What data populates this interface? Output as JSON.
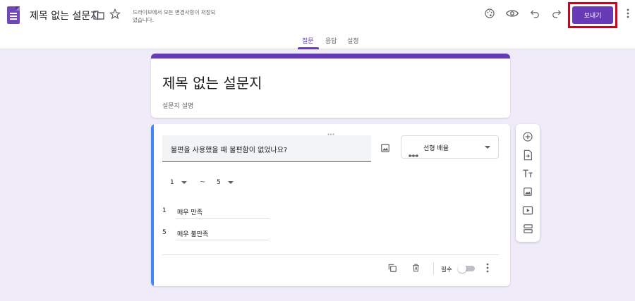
{
  "header": {
    "doc_title": "제목 없는 설문지",
    "save_status": "드라이브에서 모든 변경사항이 저장되었습니다.",
    "send_label": "보내기",
    "icons": [
      "forms-logo-icon",
      "folder-icon",
      "star-icon",
      "palette-icon",
      "preview-icon",
      "undo-icon",
      "redo-icon",
      "more-vert-icon"
    ]
  },
  "tabs": [
    {
      "label": "질문",
      "active": true
    },
    {
      "label": "응답",
      "active": false
    },
    {
      "label": "설정",
      "active": false
    }
  ],
  "form": {
    "title": "제목 없는 설문지",
    "description": "설문지 설명"
  },
  "question": {
    "text": "불편을 사용했을 때 불편함이 없었나요?",
    "type_label": "선형 배율",
    "range_min": "1",
    "range_tilde": "~",
    "range_max": "5",
    "labels": [
      {
        "num": "1",
        "text": "매우 만족"
      },
      {
        "num": "5",
        "text": "매우 불만족"
      }
    ],
    "required_label": "필수",
    "required": false
  },
  "toolbar": {
    "items": [
      "add-question-icon",
      "import-questions-icon",
      "add-title-icon",
      "add-image-icon",
      "add-video-icon",
      "add-section-icon"
    ]
  },
  "colors": {
    "accent": "#673ab7",
    "background": "#f0ebf8",
    "question_accent": "#4285f4",
    "highlight_box": "#d0021b"
  }
}
